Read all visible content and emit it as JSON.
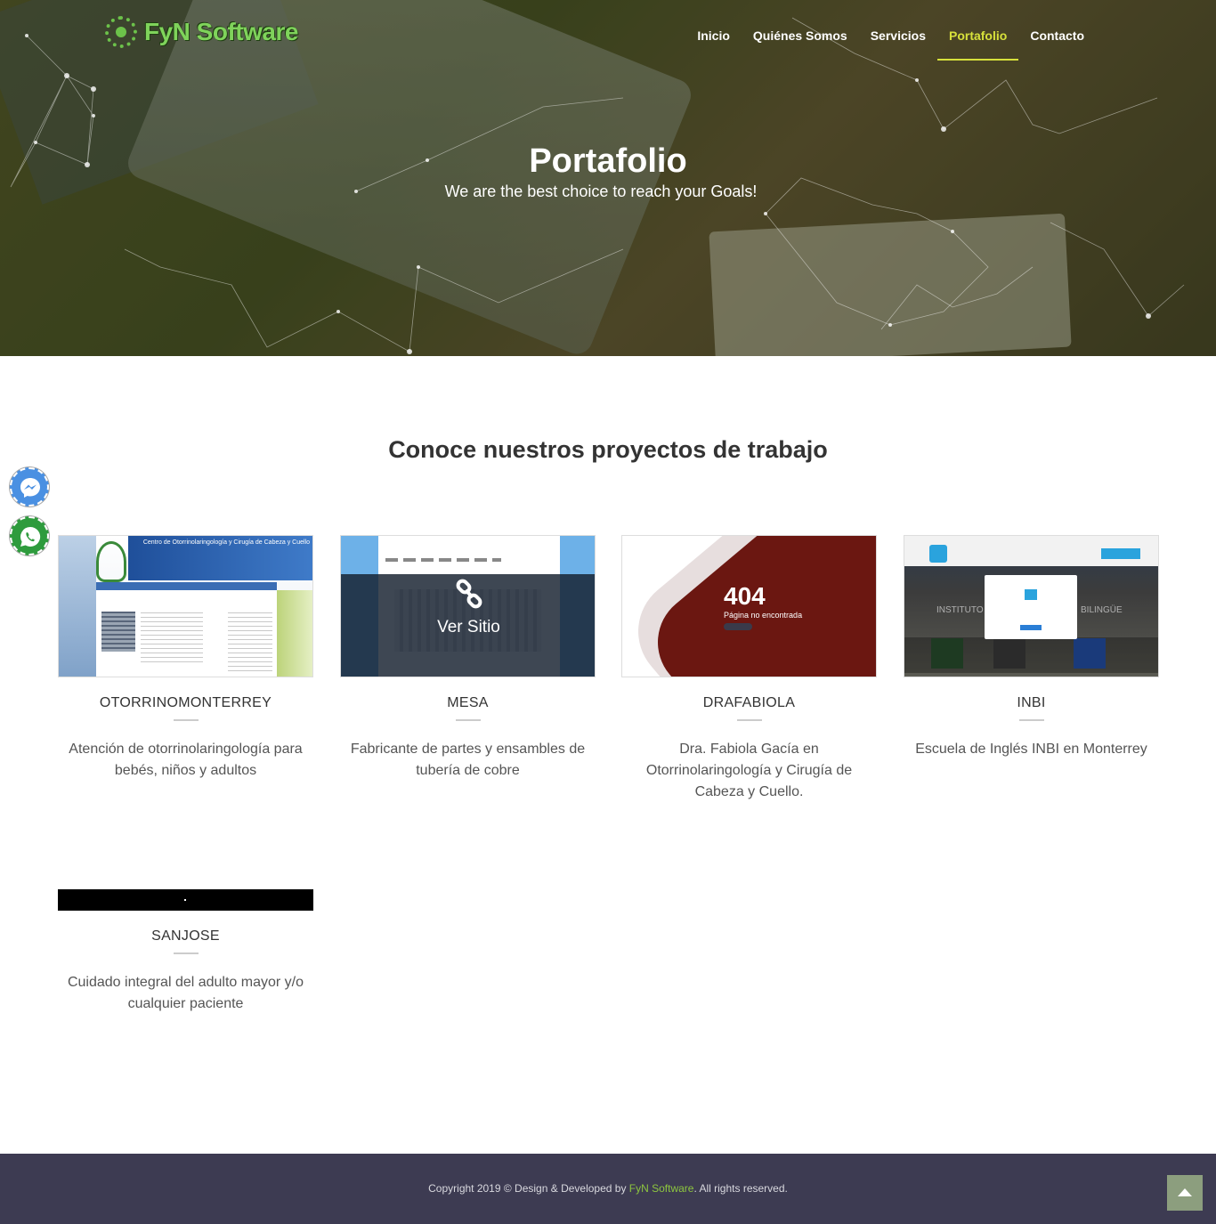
{
  "header": {
    "logo_text": "FyN Software",
    "nav": [
      {
        "label": "Inicio",
        "active": false
      },
      {
        "label": "Quiénes Somos",
        "active": false
      },
      {
        "label": "Servicios",
        "active": false
      },
      {
        "label": "Portafolio",
        "active": true
      },
      {
        "label": "Contacto",
        "active": false
      }
    ],
    "accent_color": "#d7e13b"
  },
  "hero": {
    "title": "Portafolio",
    "subtitle": "We are the best choice to reach your Goals!"
  },
  "section": {
    "title": "Conoce nuestros proyectos de trabajo"
  },
  "projects": [
    {
      "name": "OTORRINOMONTERREY",
      "description": "Atención de otorrinolaringología para bebés, niños y adultos",
      "thumb_text": "Centro de Otorrinolaringología y Cirugía de Cabeza y Cuello"
    },
    {
      "name": "MESA",
      "description": "Fabricante de partes y ensambles de tubería de cobre",
      "overlay_label": "Ver Sitio"
    },
    {
      "name": "DRAFABIOLA",
      "description": "Dra. Fabiola Gacía en Otorrinolaringología y Cirugía de Cabeza y Cuello.",
      "thumb_code": "404",
      "thumb_message": "Página no encontrada"
    },
    {
      "name": "INBI",
      "description": "Escuela de Inglés INBI en Monterrey",
      "thumb_left": "INSTITUTO",
      "thumb_right": "BILINGÜE"
    },
    {
      "name": "SANJOSE",
      "description": "Cuidado integral del adulto mayor y/o cualquier paciente"
    }
  ],
  "floating": {
    "messenger_icon": "messenger-icon",
    "whatsapp_icon": "whatsapp-icon"
  },
  "footer": {
    "prefix": "Copyright 2019 © Design & Developed by ",
    "brand": "FyN Software",
    "suffix": ". All rights reserved.",
    "brand_color": "#8dc63f",
    "back_to_top_icon": "chevron-up-icon"
  }
}
